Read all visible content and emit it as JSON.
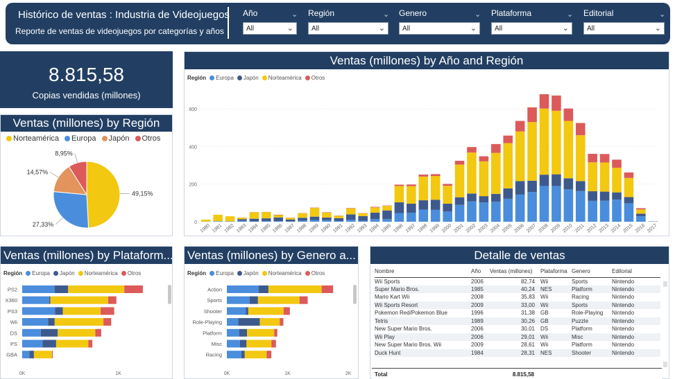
{
  "header": {
    "title": "Histórico de ventas : Industria de Videojuegos",
    "subtitle": "Reporte de ventas de videojuegos por categorías y años"
  },
  "slicers": [
    {
      "label": "Año",
      "value": "All"
    },
    {
      "label": "Región",
      "value": "All"
    },
    {
      "label": "Genero",
      "value": "All"
    },
    {
      "label": "Plataforma",
      "value": "All"
    },
    {
      "label": "Editorial",
      "value": "All"
    }
  ],
  "kpi": {
    "value": "8.815,58",
    "label": "Copias vendidas (millones)"
  },
  "pie": {
    "title": "Ventas (millones) by Región",
    "legend": [
      {
        "name": "Norteamérica",
        "color": "#f2c811"
      },
      {
        "name": "Europa",
        "color": "#4a8ddc"
      },
      {
        "name": "Japón",
        "color": "#e2945c"
      },
      {
        "name": "Otros",
        "color": "#dd5a5a"
      }
    ],
    "labels": [
      "49,15%",
      "27,33%",
      "14,57%",
      "8,95%"
    ]
  },
  "year_chart": {
    "title": "Ventas (millones) by Año and Región",
    "legend_title": "Región",
    "legend": [
      {
        "name": "Europa",
        "color": "#4a8ddc"
      },
      {
        "name": "Japón",
        "color": "#3e5a8c"
      },
      {
        "name": "Norteamérica",
        "color": "#f2c811"
      },
      {
        "name": "Otros",
        "color": "#dd5a5a"
      }
    ],
    "y_ticks": [
      "0",
      "200",
      "400",
      "600"
    ]
  },
  "platform_chart": {
    "title": "Ventas (millones) by Plataform...",
    "legend_title": "Región",
    "legend": [
      "Europa",
      "Japón",
      "Norteamérica",
      "Otros"
    ],
    "x_ticks": [
      "0K",
      "1K"
    ]
  },
  "genre_chart": {
    "title": "Ventas (millones) by Genero a...",
    "legend_title": "Región",
    "legend": [
      "Europa",
      "Japón",
      "Norteamérica",
      "Otros"
    ],
    "x_ticks": [
      "0K",
      "1K",
      "2K"
    ]
  },
  "detail": {
    "title": "Detalle de ventas",
    "columns": [
      "Nombre",
      "Año",
      "Ventas (millones)",
      "Plataforma",
      "Genero",
      "Editorial"
    ],
    "rows": [
      [
        "Wii Sports",
        "2006",
        "82,74",
        "Wii",
        "Sports",
        "Nintendo"
      ],
      [
        "Super Mario Bros.",
        "1985",
        "40,24",
        "NES",
        "Platform",
        "Nintendo"
      ],
      [
        "Mario Kart Wii",
        "2008",
        "35,83",
        "Wii",
        "Racing",
        "Nintendo"
      ],
      [
        "Wii Sports Resort",
        "2009",
        "33,00",
        "Wii",
        "Sports",
        "Nintendo"
      ],
      [
        "Pokemon Red/Pokemon Blue",
        "1996",
        "31,38",
        "GB",
        "Role-Playing",
        "Nintendo"
      ],
      [
        "Tetris",
        "1989",
        "30,26",
        "GB",
        "Puzzle",
        "Nintendo"
      ],
      [
        "New Super Mario Bros.",
        "2006",
        "30,01",
        "DS",
        "Platform",
        "Nintendo"
      ],
      [
        "Wii Play",
        "2006",
        "29,01",
        "Wii",
        "Misc",
        "Nintendo"
      ],
      [
        "New Super Mario Bros. Wii",
        "2009",
        "28,61",
        "Wii",
        "Platform",
        "Nintendo"
      ],
      [
        "Duck Hunt",
        "1984",
        "28,31",
        "NES",
        "Shooter",
        "Nintendo"
      ]
    ],
    "total_label": "Total",
    "total_value": "8.815,58"
  },
  "chart_data": [
    {
      "type": "bar",
      "title": "Ventas (millones) by Año and Región",
      "stacked": true,
      "categories": [
        "1980",
        "1981",
        "1982",
        "1983",
        "1984",
        "1985",
        "1986",
        "1987",
        "1988",
        "1989",
        "1990",
        "1991",
        "1992",
        "1993",
        "1994",
        "1995",
        "1996",
        "1997",
        "1998",
        "1999",
        "2000",
        "2001",
        "2002",
        "2003",
        "2004",
        "2005",
        "2006",
        "2007",
        "2008",
        "2009",
        "2010",
        "2011",
        "2012",
        "2013",
        "2014",
        "2015",
        "2016",
        "2017"
      ],
      "series": [
        {
          "name": "Europa",
          "values": [
            1,
            3,
            2,
            5,
            2,
            4,
            3,
            1,
            6,
            9,
            8,
            4,
            11,
            5,
            14,
            14,
            46,
            48,
            64,
            63,
            54,
            90,
            108,
            102,
            106,
            122,
            144,
            158,
            190,
            190,
            172,
            163,
            111,
            112,
            117,
            98,
            29,
            1
          ]
        },
        {
          "name": "Japón",
          "values": [
            0,
            0,
            0,
            8,
            14,
            14,
            20,
            11,
            15,
            18,
            14,
            15,
            28,
            25,
            34,
            46,
            57,
            48,
            50,
            54,
            42,
            40,
            42,
            34,
            42,
            55,
            72,
            60,
            60,
            62,
            59,
            53,
            51,
            48,
            39,
            33,
            14,
            1
          ]
        },
        {
          "name": "Norteamérica",
          "values": [
            10,
            34,
            27,
            8,
            34,
            33,
            12,
            9,
            24,
            46,
            26,
            13,
            32,
            15,
            28,
            24,
            87,
            93,
            126,
            126,
            95,
            174,
            218,
            185,
            218,
            241,
            264,
            312,
            352,
            338,
            305,
            244,
            154,
            155,
            131,
            102,
            22,
            0
          ]
        },
        {
          "name": "Otros",
          "values": [
            0,
            0,
            0,
            1,
            1,
            1,
            2,
            1,
            1,
            2,
            2,
            1,
            2,
            1,
            3,
            2,
            7,
            9,
            11,
            10,
            10,
            20,
            29,
            27,
            47,
            40,
            56,
            78,
            76,
            81,
            66,
            65,
            45,
            45,
            43,
            29,
            7,
            0
          ]
        }
      ],
      "ylim": [
        0,
        700
      ],
      "y_ticks": [
        0,
        200,
        400,
        600
      ],
      "legend": "top-left"
    },
    {
      "type": "pie",
      "title": "Ventas (millones) by Región",
      "categories": [
        "Norteamérica",
        "Europa",
        "Japón",
        "Otros"
      ],
      "values": [
        49.15,
        27.33,
        14.57,
        8.95
      ],
      "legend": "top"
    },
    {
      "type": "bar",
      "title": "Ventas (millones) by Plataform...",
      "orientation": "horizontal",
      "stacked": true,
      "categories": [
        "PS2",
        "X360",
        "PS3",
        "Wii",
        "DS",
        "PS",
        "GBA"
      ],
      "series": [
        {
          "name": "Europa",
          "values": [
            339,
            280,
            343,
            269,
            194,
            213,
            75
          ]
        },
        {
          "name": "Japón",
          "values": [
            139,
            13,
            80,
            69,
            176,
            140,
            47
          ]
        },
        {
          "name": "Norteamérica",
          "values": [
            584,
            602,
            393,
            507,
            391,
            336,
            188
          ]
        },
        {
          "name": "Otros",
          "values": [
            193,
            85,
            141,
            81,
            61,
            41,
            8
          ]
        }
      ],
      "xlim": [
        0,
        1400
      ],
      "x_ticks": [
        "0K",
        "1K"
      ]
    },
    {
      "type": "bar",
      "title": "Ventas (millones) by Genero a...",
      "orientation": "horizontal",
      "stacked": true,
      "categories": [
        "Action",
        "Sports",
        "Shooter",
        "Role-Playing",
        "Platform",
        "Misc",
        "Racing"
      ],
      "series": [
        {
          "name": "Europa",
          "values": [
            525,
            377,
            314,
            188,
            202,
            216,
            238
          ]
        },
        {
          "name": "Japón",
          "values": [
            160,
            136,
            39,
            356,
            131,
            108,
            57
          ]
        },
        {
          "name": "Norteamérica",
          "values": [
            877,
            684,
            582,
            327,
            447,
            410,
            360
          ]
        },
        {
          "name": "Otros",
          "values": [
            188,
            135,
            103,
            60,
            51,
            75,
            78
          ]
        }
      ],
      "xlim": [
        0,
        2000
      ],
      "x_ticks": [
        "0K",
        "1K",
        "2K"
      ]
    }
  ]
}
